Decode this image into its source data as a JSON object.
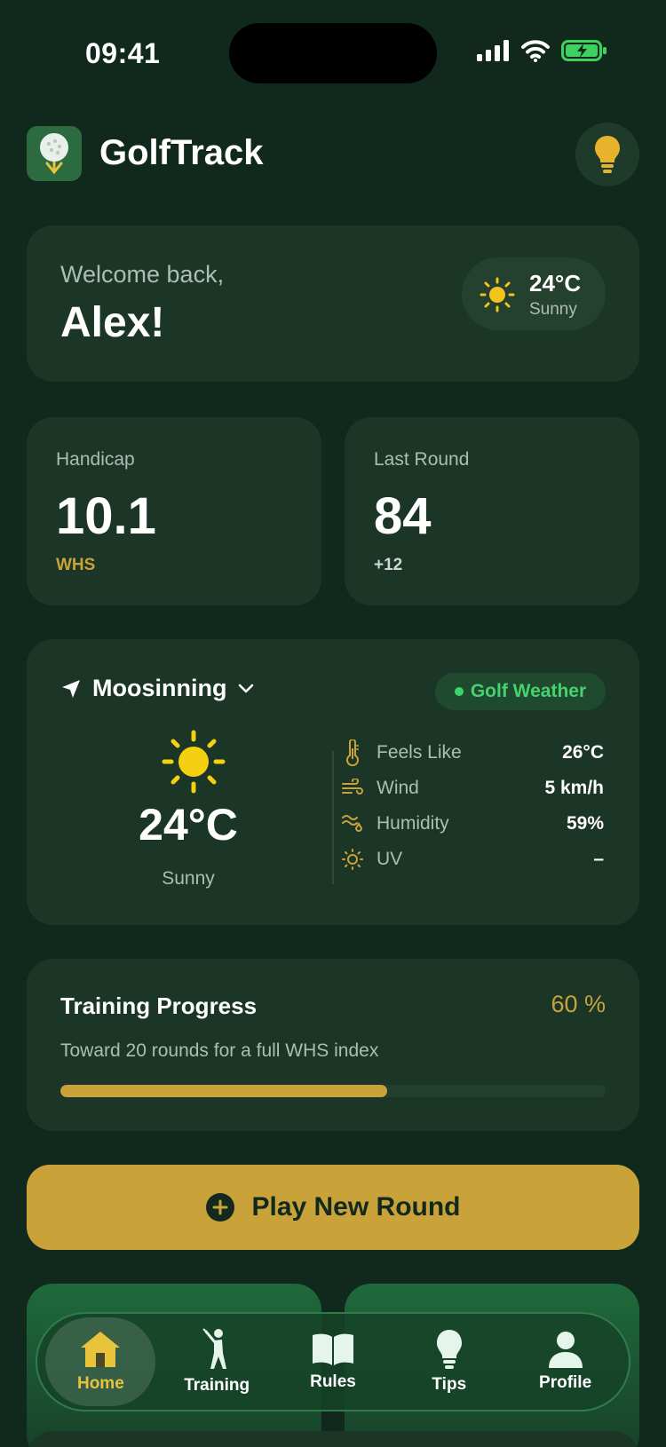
{
  "status_bar": {
    "time": "09:41"
  },
  "header": {
    "app_name": "GolfTrack"
  },
  "welcome": {
    "greeting": "Welcome back,",
    "name": "Alex!",
    "temp": "24°C",
    "condition": "Sunny"
  },
  "stats": [
    {
      "label": "Handicap",
      "value": "10.1",
      "sub": "WHS",
      "sub_color": "#c9a23a"
    },
    {
      "label": "Last Round",
      "value": "84",
      "sub": "+12",
      "sub_color": "#cfd8d2"
    }
  ],
  "weather": {
    "location": "Moosinning",
    "badge": "Golf Weather",
    "temp": "24°C",
    "condition": "Sunny",
    "rows": [
      {
        "icon": "thermometer-icon",
        "label": "Feels Like",
        "value": "26°C"
      },
      {
        "icon": "wind-icon",
        "label": "Wind",
        "value": "5 km/h"
      },
      {
        "icon": "humidity-icon",
        "label": "Humidity",
        "value": "59%"
      },
      {
        "icon": "uv-icon",
        "label": "UV",
        "value": "–"
      }
    ]
  },
  "training": {
    "title": "Training Progress",
    "percent_label": "60 %",
    "progress": 0.6,
    "description": "Toward 20 rounds for a full WHS index"
  },
  "play_button": {
    "label": "Play New Round"
  },
  "nav": [
    {
      "label": "Home",
      "icon": "home-icon",
      "active": true
    },
    {
      "label": "Training",
      "icon": "golfer-icon",
      "active": false
    },
    {
      "label": "Rules",
      "icon": "book-icon",
      "active": false
    },
    {
      "label": "Tips",
      "icon": "lightbulb-icon",
      "active": false
    },
    {
      "label": "Profile",
      "icon": "person-icon",
      "active": false
    }
  ],
  "colors": {
    "background": "#11291c",
    "card": "#1b3626",
    "accent": "#c9a23a",
    "success": "#47d26d"
  }
}
